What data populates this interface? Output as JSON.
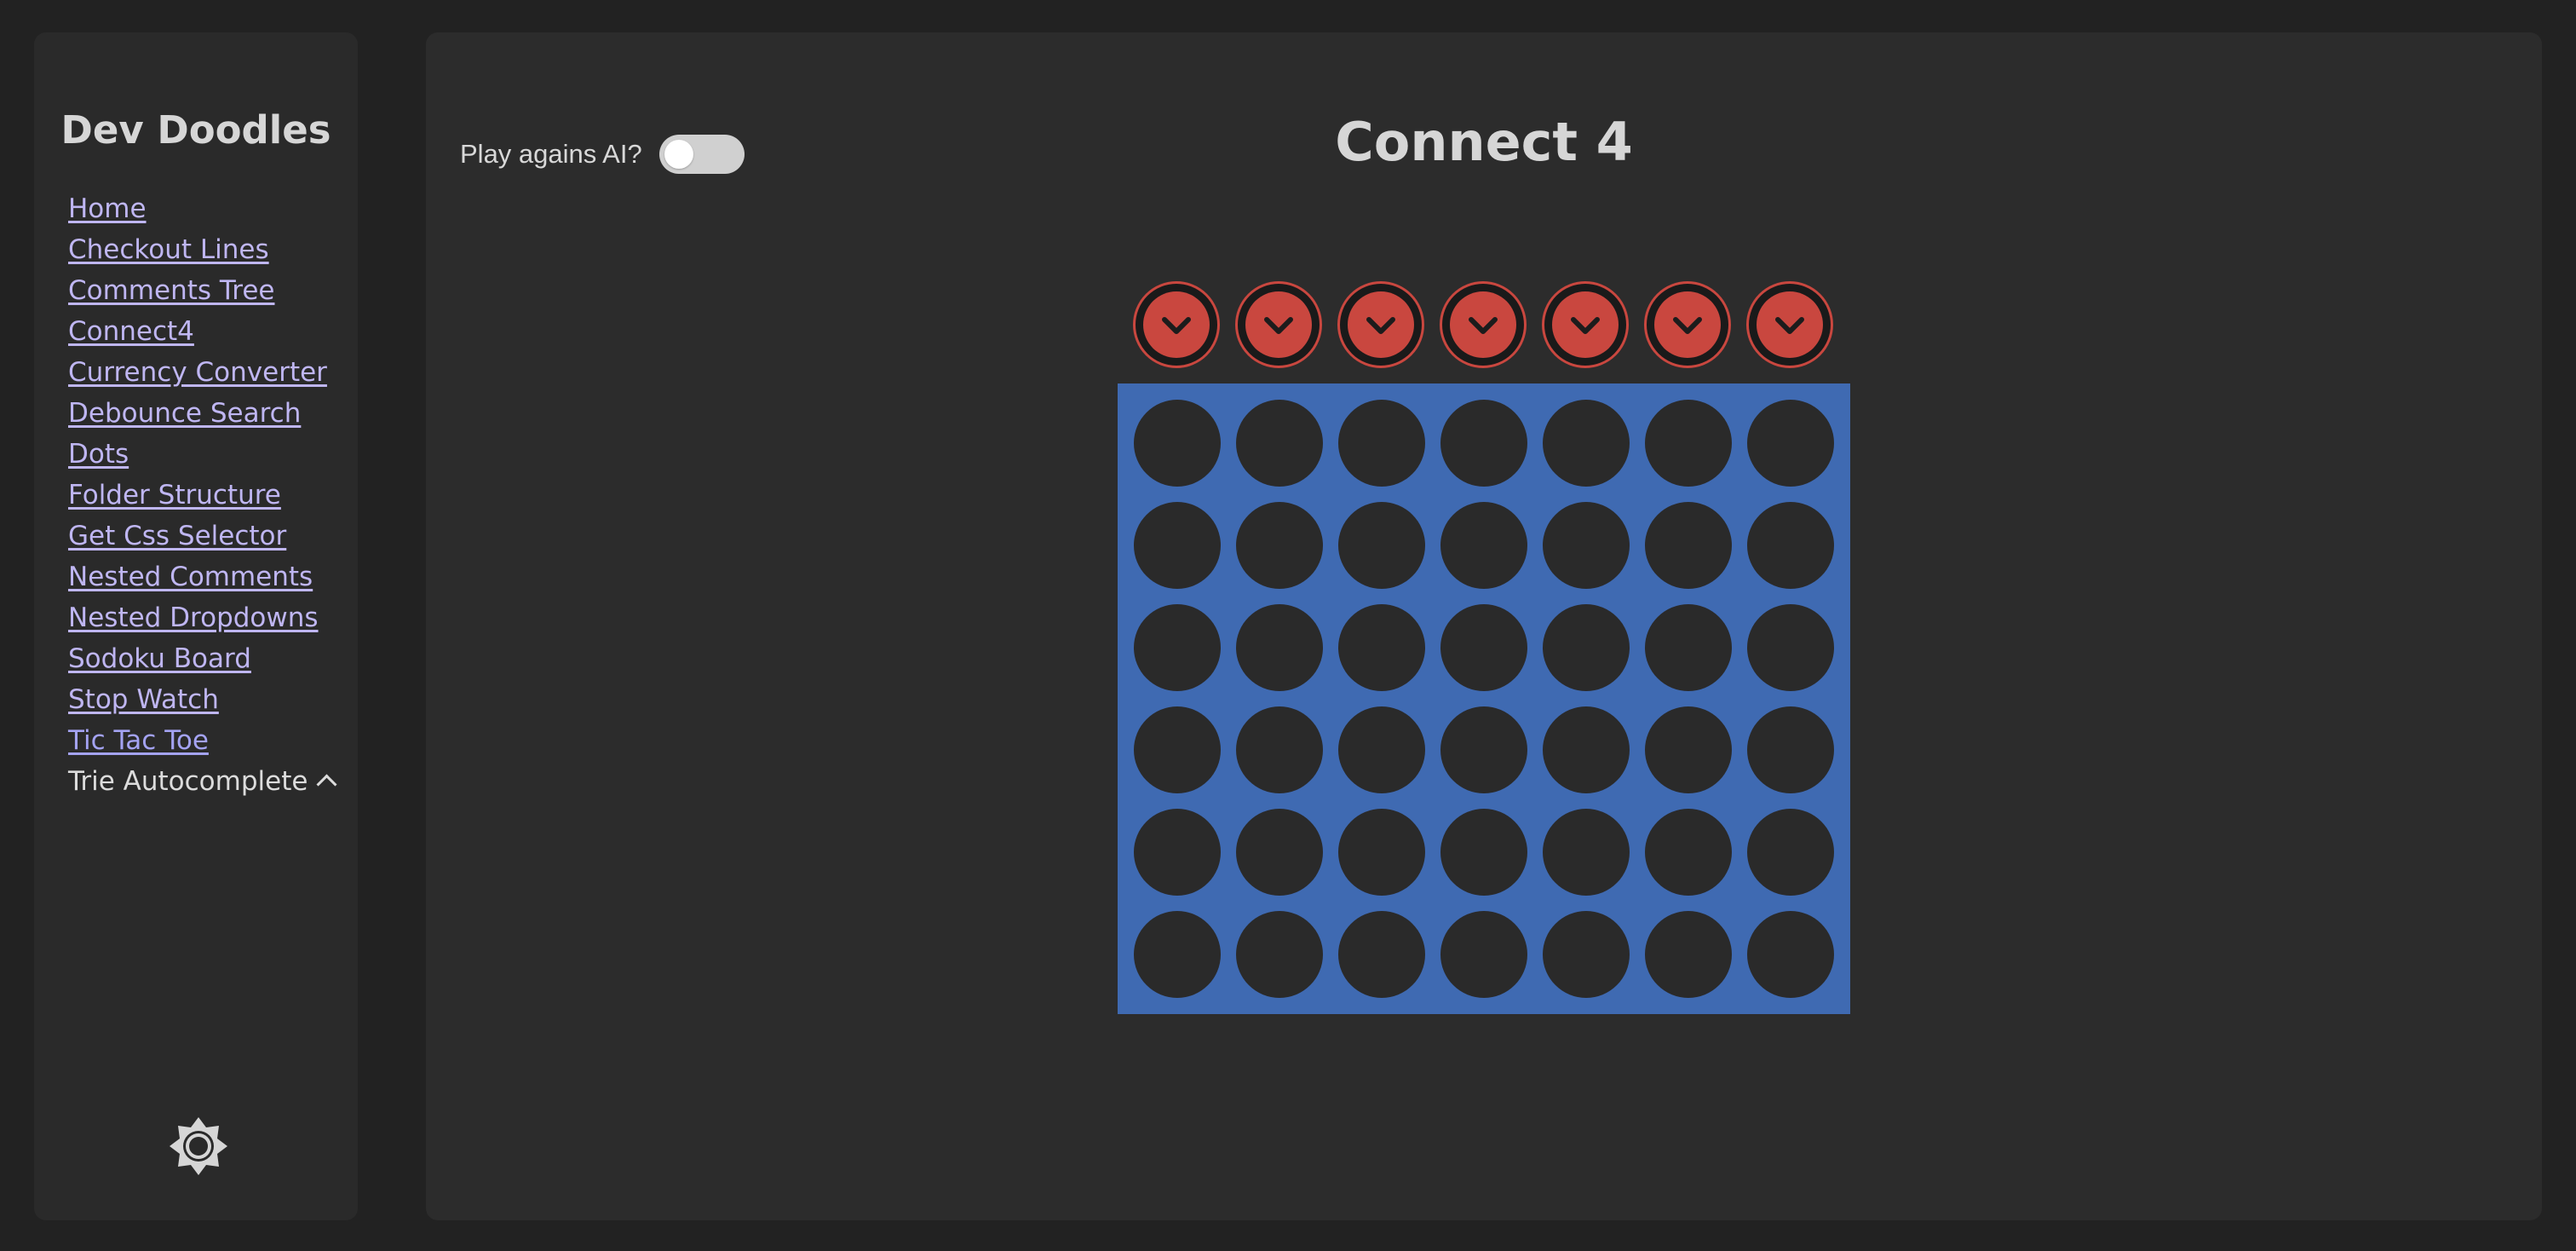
{
  "sidebar": {
    "brand": "Dev Doodles",
    "items": [
      {
        "label": "Home"
      },
      {
        "label": "Checkout Lines"
      },
      {
        "label": "Comments Tree"
      },
      {
        "label": "Connect4"
      },
      {
        "label": "Currency Converter"
      },
      {
        "label": "Debounce Search"
      },
      {
        "label": "Dots"
      },
      {
        "label": "Folder Structure"
      },
      {
        "label": "Get Css Selector"
      },
      {
        "label": "Nested Comments"
      },
      {
        "label": "Nested Dropdowns"
      },
      {
        "label": "Sodoku Board"
      },
      {
        "label": "Stop Watch"
      },
      {
        "label": "Tic Tac Toe"
      },
      {
        "label": "Trie Autocomplete"
      }
    ],
    "theme_icon": "sun-icon"
  },
  "main": {
    "title": "Connect 4",
    "ai_toggle": {
      "label": "Play agains AI?",
      "on": false
    },
    "board": {
      "columns": 7,
      "rows": 6,
      "drop_icon": "chevron-down-icon",
      "cells": [
        [
          "",
          "",
          "",
          "",
          "",
          "",
          ""
        ],
        [
          "",
          "",
          "",
          "",
          "",
          "",
          ""
        ],
        [
          "",
          "",
          "",
          "",
          "",
          "",
          ""
        ],
        [
          "",
          "",
          "",
          "",
          "",
          "",
          ""
        ],
        [
          "",
          "",
          "",
          "",
          "",
          "",
          ""
        ],
        [
          "",
          "",
          "",
          "",
          "",
          "",
          ""
        ]
      ]
    }
  },
  "colors": {
    "page_bg": "#222222",
    "panel_bg": "#2a2a2a",
    "board_blue": "#3f6ab2",
    "player_red": "#c9473f",
    "link": "#bfb6f2"
  }
}
